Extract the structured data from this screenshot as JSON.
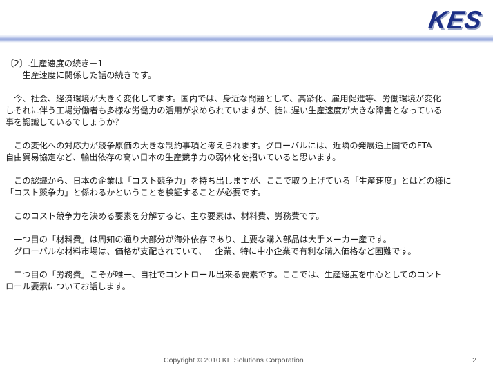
{
  "header": {
    "logo_text": "KES"
  },
  "content": {
    "heading": "〔2〕.生産速度の続き－1",
    "subheading": "　　生産速度に関係した話の続きです。",
    "paragraphs": [
      [
        "　今、社会、経済環境が大きく変化してます。国内では、身近な問題として、高齢化、雇用促進等、労働環境が変化",
        "しそれに伴う工場労働者も多様な労働力の活用が求められていますが、徒に遅い生産速度が大きな障害となっている",
        "事を認識しているでしょうか？"
      ],
      [
        "　この変化への対応力が競争原価の大きな制約事項と考えられます。グローバルには、近隣の発展途上国でのFTA",
        "自由貿易協定など、輸出依存の高い日本の生産競争力の弱体化を招いていると思います。"
      ],
      [
        "　この認識から、日本の企業は「コスト競争力」を持ち出しますが、ここで取り上げている「生産速度」とはどの様に",
        "「コスト競争力」と係わるかということを検証することが必要です。"
      ],
      [
        "　このコスト競争力を決める要素を分解すると、主な要素は、材料費、労務費です。"
      ],
      [
        "　一つ目の「材料費」は周知の通り大部分が海外依存であり、主要な購入部品は大手メーカー産です。",
        "　グローバルな材料市場は、価格が支配されていて、一企業、特に中小企業で有利な購入価格など困難です。"
      ],
      [
        "　二つ目の「労務費」こそが唯一、自社でコントロール出来る要素です。ここでは、生産速度を中心としてのコント",
        "ロール要素についてお話します。"
      ]
    ]
  },
  "footer": {
    "copyright": "Copyright  © 2010 KE Solutions  Corporation",
    "page_number": "2"
  },
  "colors": {
    "logo": "#1c2f86",
    "rule": "#8fa2db"
  }
}
